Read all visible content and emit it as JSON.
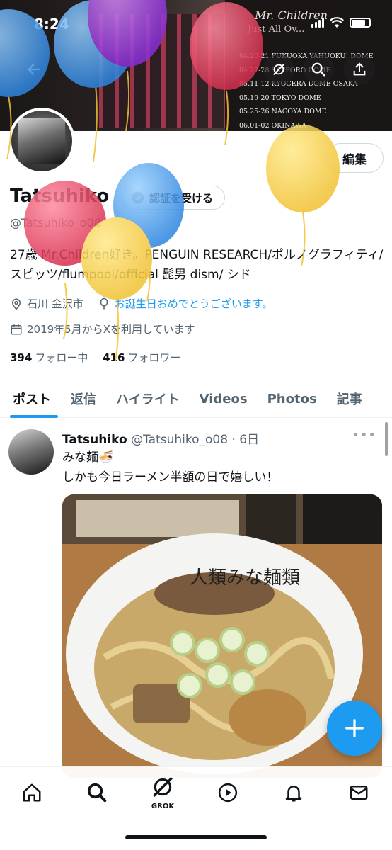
{
  "status_bar": {
    "time": "8:24"
  },
  "banner": {
    "band_title": "Mr. Children",
    "band_subtitle": "Just All Ov...",
    "dates": [
      "04.20-21 FUKUOKA YAHUOKU! DOME",
      "04.27-28 SAPPORO DOME",
      "05.11-12 KYOCERA DOME OSAKA",
      "05.19-20 TOKYO DOME",
      "05.25-26 NAGOYA DOME",
      "06.01-02 OKINAWA"
    ]
  },
  "header": {
    "back_icon": "arrow-left-icon",
    "grok_icon": "grok-icon",
    "search_icon": "search-icon",
    "share_icon": "share-icon"
  },
  "profile": {
    "edit_label": "編集",
    "name": "Tatsuhiko",
    "verify_label": "認証を受ける",
    "handle": "@Tatsuhiko_o08",
    "bio": "27歳 Mr.Children好き。PENGUIN RESEARCH/ポルノグラフィティ/スピッツ/flumpool/official 髭男 dism/ シド",
    "location": "石川 金沢市",
    "birthday": "お誕生日おめでとうございます。",
    "joined": "2019年5月からXを利用しています",
    "following_count": "394",
    "following_label": "フォロー中",
    "followers_count": "416",
    "followers_label": "フォロワー"
  },
  "tabs": [
    {
      "label": "ポスト",
      "active": true
    },
    {
      "label": "返信"
    },
    {
      "label": "ハイライト"
    },
    {
      "label": "Videos"
    },
    {
      "label": "Photos"
    },
    {
      "label": "記事"
    }
  ],
  "post": {
    "name": "Tatsuhiko",
    "handle": "@Tatsuhiko_o08",
    "time": "6日",
    "line1": "みな麺🍜",
    "line2": "しかも今日ラーメン半額の日で嬉しい！",
    "image_text": "人類みな麺類"
  },
  "nav": {
    "items": [
      "home-icon",
      "search-icon",
      "grok-icon",
      "play-icon",
      "bell-icon",
      "mail-icon"
    ],
    "grok_label": "GROK"
  },
  "colors": {
    "accent": "#1d9bf0",
    "text": "#0f1419",
    "muted": "#536471"
  }
}
